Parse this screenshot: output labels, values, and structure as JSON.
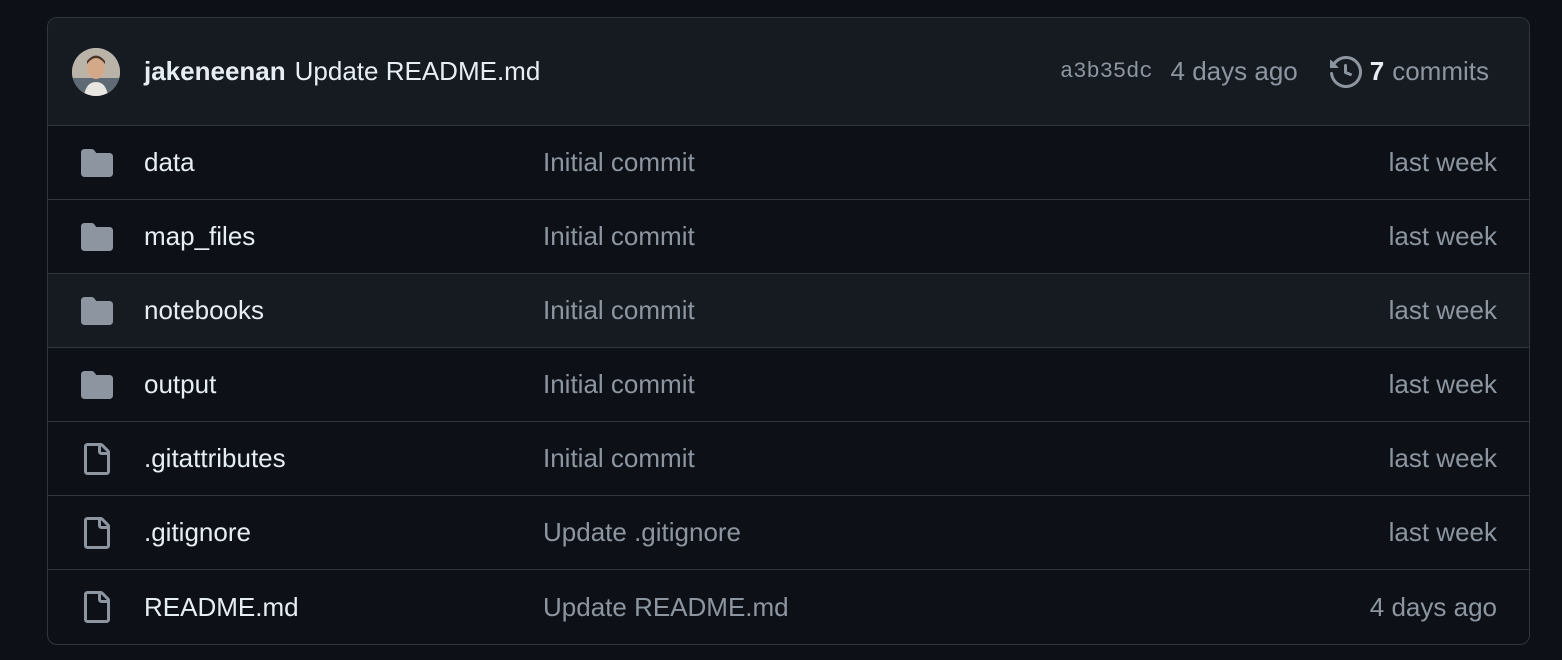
{
  "latest_commit": {
    "author": "jakeneenan",
    "message": "Update README.md",
    "sha": "a3b35dc",
    "time_ago": "4 days ago",
    "commits_count": "7",
    "commits_label": "commits"
  },
  "files": [
    {
      "name": "data",
      "type": "folder",
      "message": "Initial commit",
      "date": "last week"
    },
    {
      "name": "map_files",
      "type": "folder",
      "message": "Initial commit",
      "date": "last week"
    },
    {
      "name": "notebooks",
      "type": "folder",
      "message": "Initial commit",
      "date": "last week"
    },
    {
      "name": "output",
      "type": "folder",
      "message": "Initial commit",
      "date": "last week"
    },
    {
      "name": ".gitattributes",
      "type": "file",
      "message": "Initial commit",
      "date": "last week"
    },
    {
      "name": ".gitignore",
      "type": "file",
      "message": "Update .gitignore",
      "date": "last week"
    },
    {
      "name": "README.md",
      "type": "file",
      "message": "Update README.md",
      "date": "4 days ago"
    }
  ],
  "colors": {
    "background": "#0d1117",
    "header_bg": "#161b22",
    "border": "#30363d",
    "text": "#e6edf3",
    "muted": "#8d96a0",
    "folder_icon": "#8d96a0"
  }
}
